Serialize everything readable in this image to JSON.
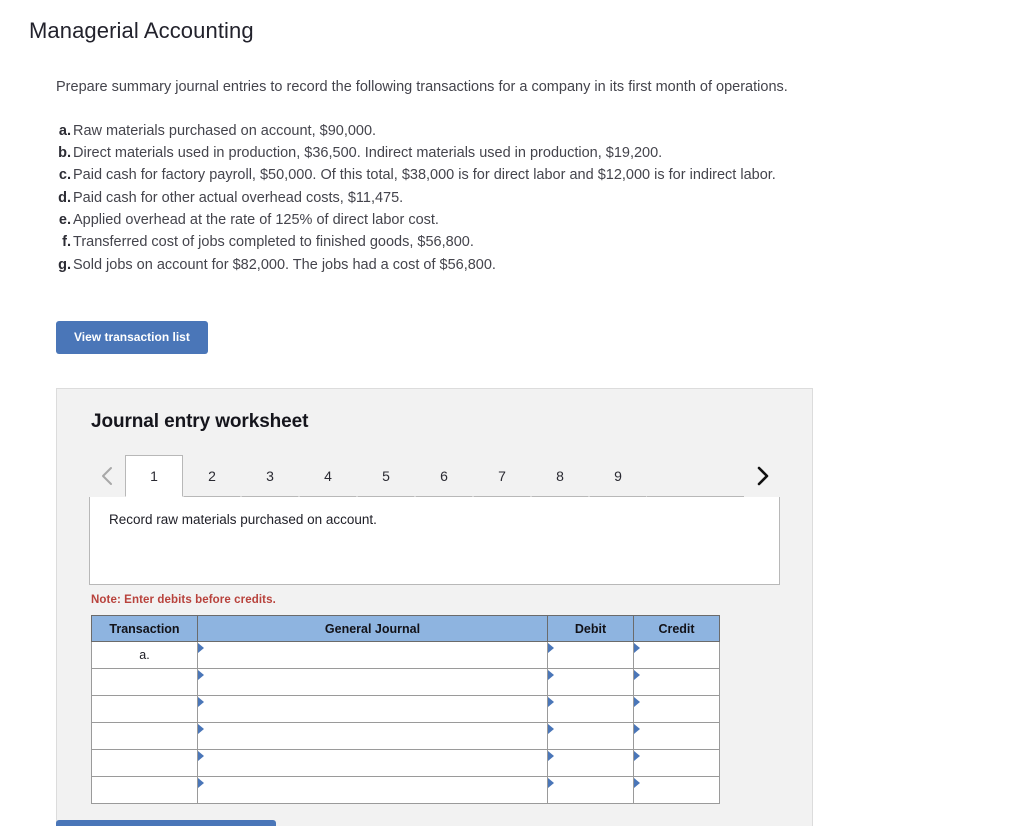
{
  "page": {
    "title": "Managerial Accounting"
  },
  "problem": {
    "lead": "Prepare summary journal entries to record the following transactions for a company in its first month of operations.",
    "items": [
      {
        "label": "a.",
        "text": "Raw materials purchased on account, $90,000."
      },
      {
        "label": "b.",
        "text": "Direct materials used in production, $36,500. Indirect materials used in production, $19,200."
      },
      {
        "label": "c.",
        "text": "Paid cash for factory payroll, $50,000. Of this total, $38,000 is for direct labor and $12,000 is for indirect labor."
      },
      {
        "label": "d.",
        "text": "Paid cash for other actual overhead costs, $11,475."
      },
      {
        "label": "e.",
        "text": "Applied overhead at the rate of 125% of direct labor cost."
      },
      {
        "label": "f.",
        "text": "Transferred cost of jobs completed to finished goods, $56,800."
      },
      {
        "label": "g.",
        "text": "Sold jobs on account for $82,000. The jobs had a cost of $56,800."
      }
    ]
  },
  "actions": {
    "view_transaction_list": "View transaction list"
  },
  "worksheet": {
    "title": "Journal entry worksheet",
    "prev_icon": "chevron-left-icon",
    "next_icon": "chevron-right-icon",
    "tabs": [
      {
        "label": "1",
        "active": true
      },
      {
        "label": "2",
        "active": false
      },
      {
        "label": "3",
        "active": false
      },
      {
        "label": "4",
        "active": false
      },
      {
        "label": "5",
        "active": false
      },
      {
        "label": "6",
        "active": false
      },
      {
        "label": "7",
        "active": false
      },
      {
        "label": "8",
        "active": false
      },
      {
        "label": "9",
        "active": false
      }
    ],
    "prompt": "Record raw materials purchased on account.",
    "note": "Note: Enter debits before credits.",
    "table": {
      "headers": [
        "Transaction",
        "General Journal",
        "Debit",
        "Credit"
      ],
      "rows": [
        {
          "transaction": "a.",
          "general_journal": "",
          "debit": "",
          "credit": ""
        },
        {
          "transaction": "",
          "general_journal": "",
          "debit": "",
          "credit": ""
        },
        {
          "transaction": "",
          "general_journal": "",
          "debit": "",
          "credit": ""
        },
        {
          "transaction": "",
          "general_journal": "",
          "debit": "",
          "credit": ""
        },
        {
          "transaction": "",
          "general_journal": "",
          "debit": "",
          "credit": ""
        },
        {
          "transaction": "",
          "general_journal": "",
          "debit": "",
          "credit": ""
        }
      ]
    }
  },
  "colors": {
    "accent_blue": "#4a76b8",
    "table_header_blue": "#8eb4e0",
    "note_red": "#b8423c",
    "panel_gray": "#f2f2f2"
  }
}
